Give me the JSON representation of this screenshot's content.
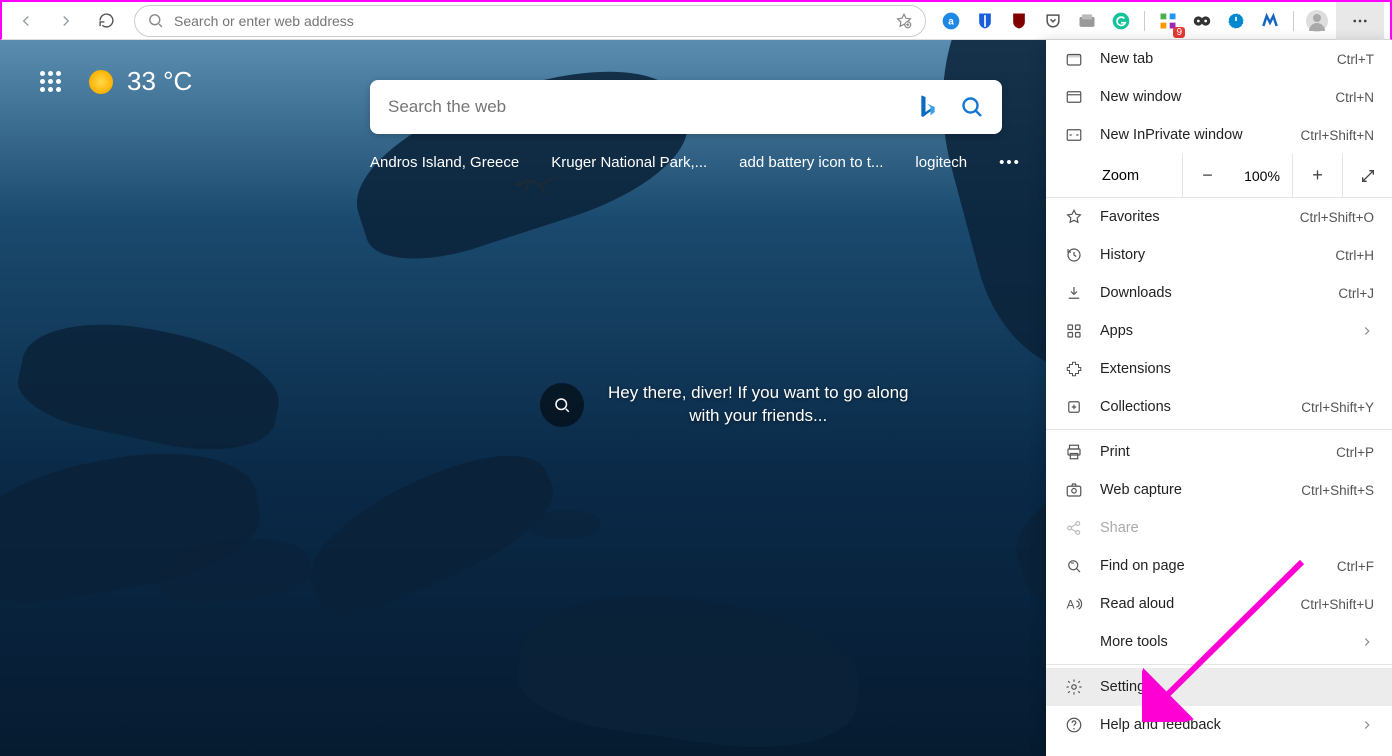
{
  "toolbar": {
    "address_placeholder": "Search or enter web address",
    "extensions_badge": "9"
  },
  "ntp": {
    "temperature": "33 °C",
    "search_placeholder": "Search the web",
    "suggestions": [
      "Andros Island, Greece",
      "Kruger National Park,...",
      "add battery icon to t...",
      "logitech"
    ],
    "caption_line1": "Hey there, diver! If you want to go along",
    "caption_line2": "with your friends..."
  },
  "menu": {
    "items1": [
      {
        "icon": "tab",
        "label": "New tab",
        "shortcut": "Ctrl+T"
      },
      {
        "icon": "window",
        "label": "New window",
        "shortcut": "Ctrl+N"
      },
      {
        "icon": "inprivate",
        "label": "New InPrivate window",
        "shortcut": "Ctrl+Shift+N"
      }
    ],
    "zoom_label": "Zoom",
    "zoom_value": "100%",
    "items2": [
      {
        "icon": "star",
        "label": "Favorites",
        "shortcut": "Ctrl+Shift+O"
      },
      {
        "icon": "history",
        "label": "History",
        "shortcut": "Ctrl+H"
      },
      {
        "icon": "download",
        "label": "Downloads",
        "shortcut": "Ctrl+J"
      },
      {
        "icon": "apps",
        "label": "Apps",
        "chevron": true
      },
      {
        "icon": "ext",
        "label": "Extensions"
      },
      {
        "icon": "collections",
        "label": "Collections",
        "shortcut": "Ctrl+Shift+Y"
      }
    ],
    "items3": [
      {
        "icon": "print",
        "label": "Print",
        "shortcut": "Ctrl+P"
      },
      {
        "icon": "capture",
        "label": "Web capture",
        "shortcut": "Ctrl+Shift+S"
      },
      {
        "icon": "share",
        "label": "Share",
        "disabled": true
      },
      {
        "icon": "find",
        "label": "Find on page",
        "shortcut": "Ctrl+F"
      },
      {
        "icon": "read",
        "label": "Read aloud",
        "shortcut": "Ctrl+Shift+U"
      },
      {
        "icon": "more",
        "label": "More tools",
        "chevron": true
      }
    ],
    "items4": [
      {
        "icon": "settings",
        "label": "Settings",
        "highlighted": true
      },
      {
        "icon": "help",
        "label": "Help and feedback",
        "chevron": true
      }
    ]
  }
}
